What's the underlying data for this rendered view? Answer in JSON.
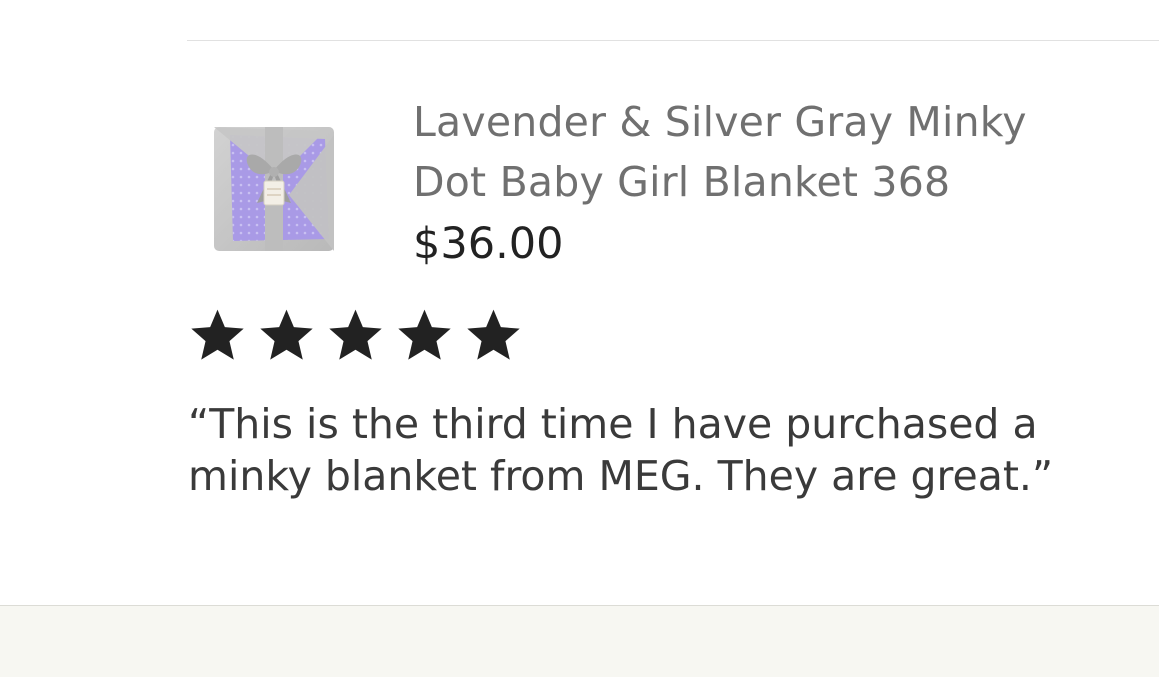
{
  "product": {
    "title": "Lavender & Silver Gray Minky Dot Baby Girl Blanket 368",
    "price": "$36.00",
    "thumbnail_icon": "blanket-product-thumbnail",
    "colors": {
      "blanket_gray": "#c8c8c8",
      "blanket_lavender": "#a99ae6",
      "ribbon_gray": "#bfbfbf"
    }
  },
  "review": {
    "rating": 5,
    "rating_max": 5,
    "star_color": "#222222",
    "text": "“This is the third time I have purchased a\nminky blanket from MEG.  They are great.”"
  },
  "colors": {
    "divider": "#e1e1e1",
    "footer_background": "#f7f7f2",
    "title_text": "#707070",
    "price_text": "#222222",
    "review_text": "#3a3a3a"
  }
}
